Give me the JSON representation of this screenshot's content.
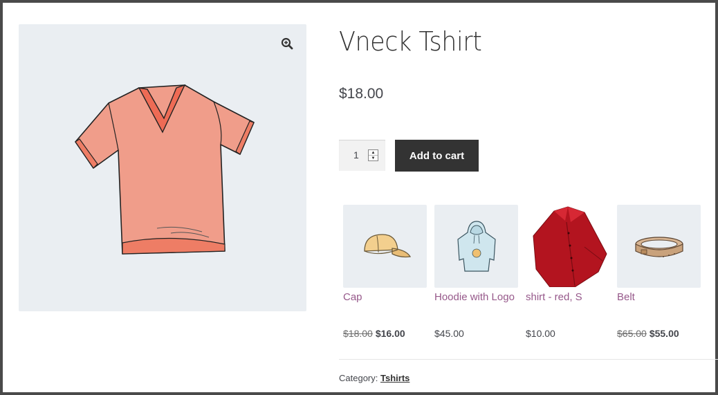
{
  "product": {
    "title": "Vneck Tshirt",
    "price": "$18.00",
    "quantity": "1",
    "add_to_cart_label": "Add to cart",
    "image_icon": "vneck-tshirt-image",
    "zoom_icon": "zoom-in-icon"
  },
  "related": [
    {
      "name": "Cap",
      "old_price": "$18.00",
      "price": "$16.00",
      "icon": "cap-image"
    },
    {
      "name": "Hoodie with Logo",
      "old_price": "",
      "price": "$45.00",
      "icon": "hoodie-image"
    },
    {
      "name": "shirt - red, S",
      "old_price": "",
      "price": "$10.00",
      "icon": "red-shirt-image"
    },
    {
      "name": "Belt",
      "old_price": "$65.00",
      "price": "$55.00",
      "icon": "belt-image"
    }
  ],
  "meta": {
    "category_label": "Category:",
    "category_value": "Tshirts"
  },
  "colors": {
    "button_bg": "#333333",
    "link": "#96588a",
    "image_bg": "#eaeef2"
  }
}
